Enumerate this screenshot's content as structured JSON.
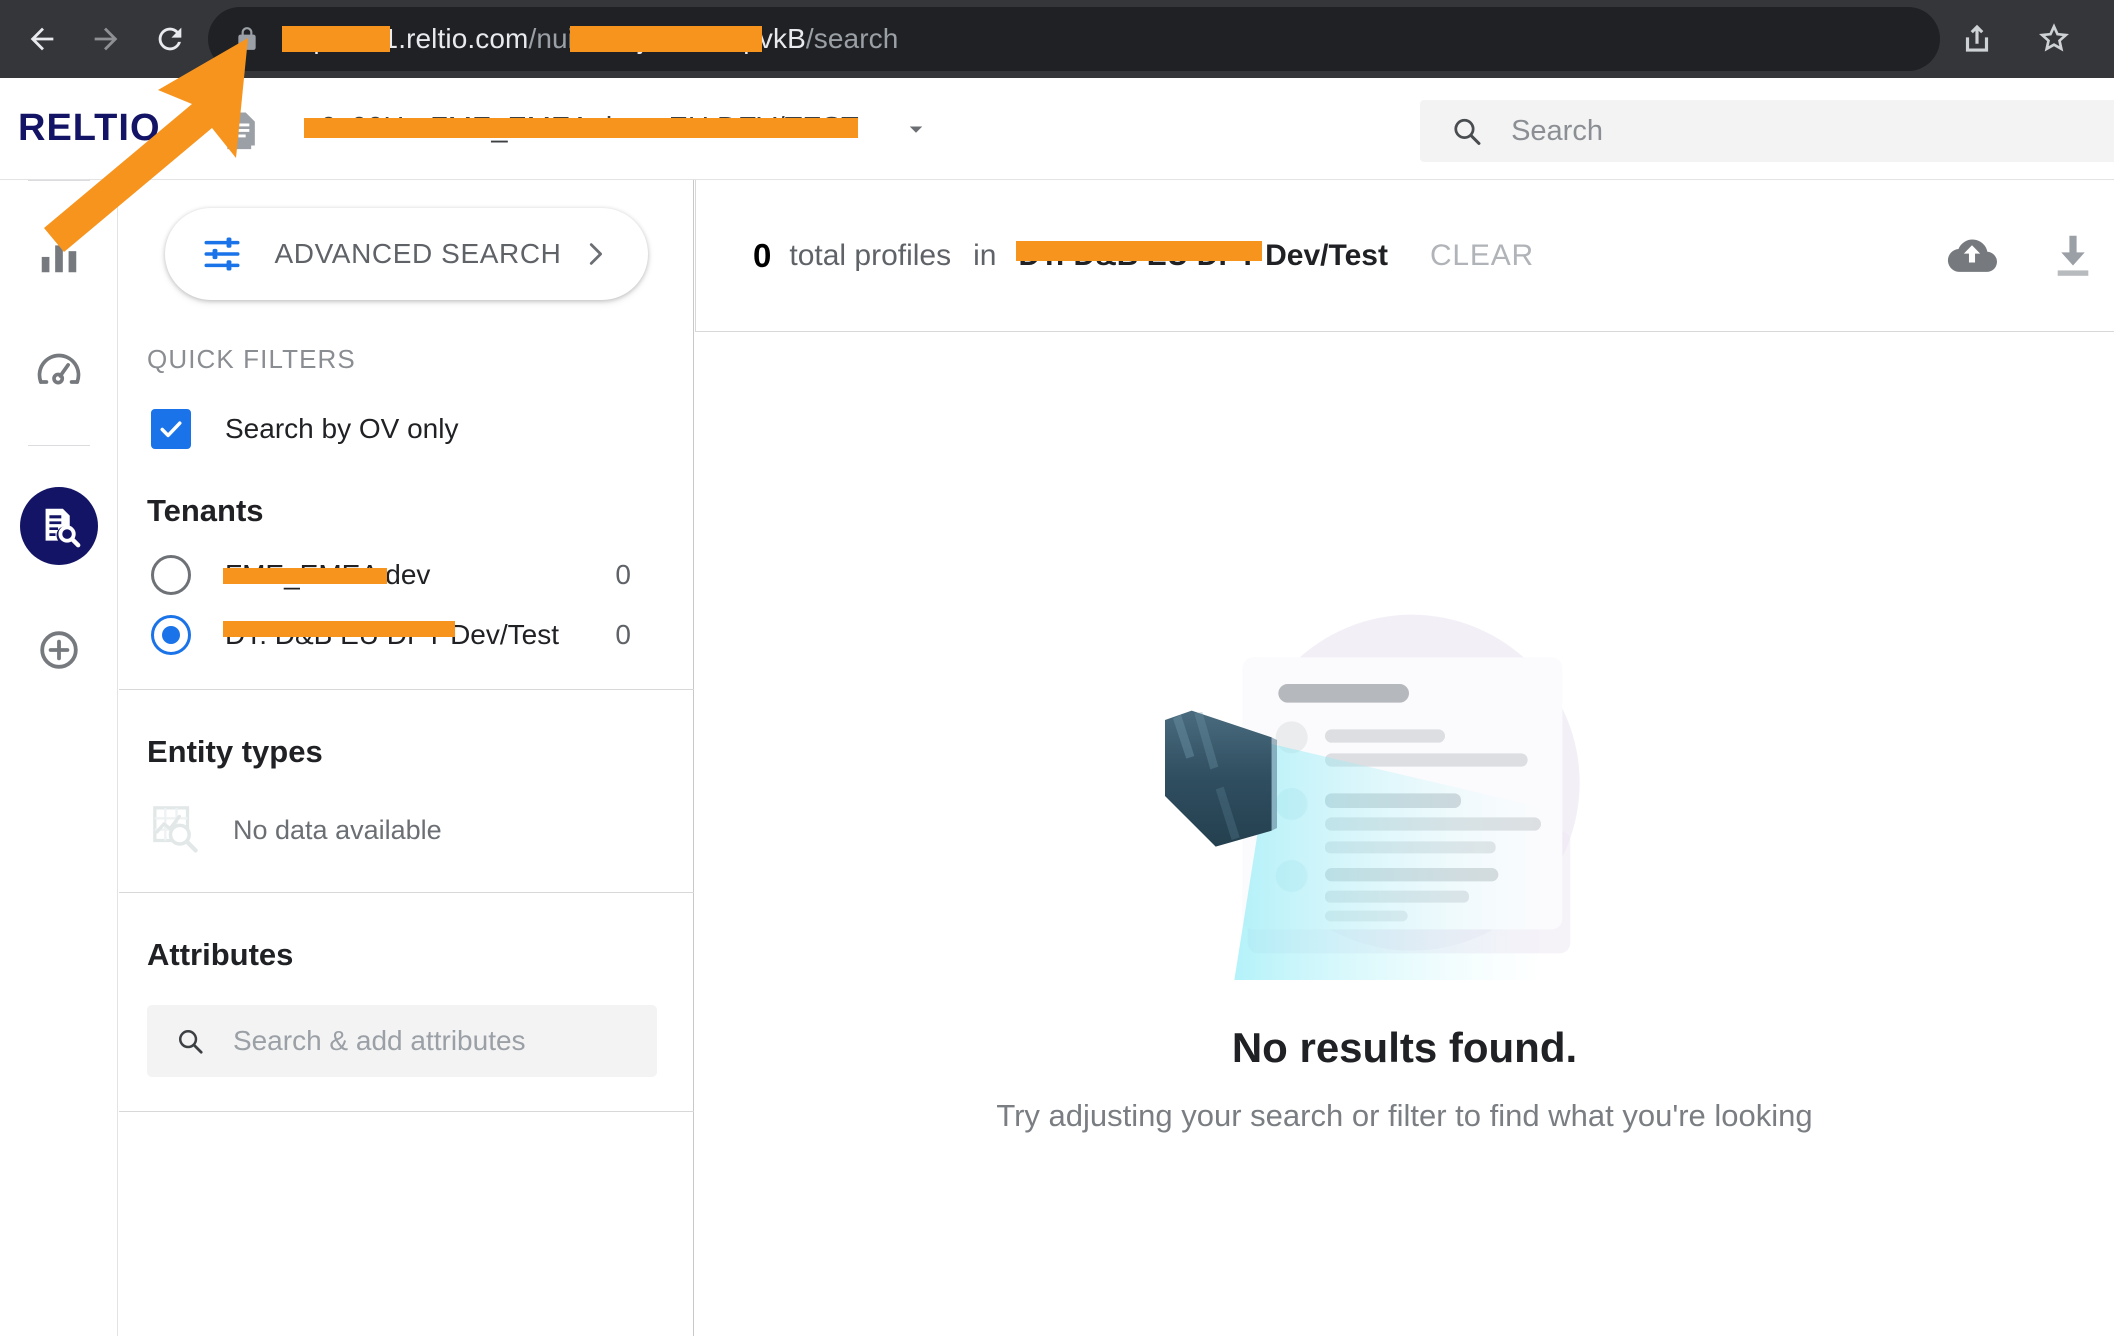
{
  "browser": {
    "back_icon": "back-arrow-icon",
    "forward_icon": "forward-arrow-icon",
    "reload_icon": "reload-icon",
    "lock_icon": "lock-icon",
    "url_prefix_redacted": "",
    "url_visible_1": "01",
    "url_domain": ".reltio.com",
    "url_path_1": "/nui/r",
    "url_redacted_2": "",
    "url_path_2": "/search",
    "share_icon": "share-icon",
    "bookmark_icon": "star-icon"
  },
  "header": {
    "logo": "RELTIO",
    "doc_icon": "document-icon",
    "tenant_name": "",
    "caret_icon": "chevron-down-icon",
    "search": {
      "icon": "search-icon",
      "value": "",
      "placeholder": "Search"
    }
  },
  "rail": {
    "items": [
      {
        "name": "analytics",
        "icon": "bar-chart-icon",
        "active": false
      },
      {
        "name": "dashboard",
        "icon": "gauge-icon",
        "active": false
      },
      {
        "name": "search",
        "icon": "document-search-icon",
        "active": true
      },
      {
        "name": "add",
        "icon": "plus-circle-icon",
        "active": false
      }
    ]
  },
  "facets": {
    "advanced_search": {
      "icon": "filter-sliders-icon",
      "label": "ADVANCED SEARCH",
      "chevron": "chevron-right-icon"
    },
    "quick_filters_title": "QUICK FILTERS",
    "ov_checkbox": {
      "label": "Search by OV only",
      "checked": true,
      "icon": "checkmark-icon"
    },
    "tenants": {
      "title": "Tenants",
      "rows": [
        {
          "label": "",
          "count": "0",
          "selected": false
        },
        {
          "label": "",
          "count": "0",
          "selected": true
        }
      ]
    },
    "entity_types": {
      "title": "Entity types",
      "empty_icon": "chart-search-icon",
      "empty_label": "No data available"
    },
    "attributes": {
      "title": "Attributes",
      "search_icon": "search-icon",
      "value": "",
      "placeholder": "Search & add attributes"
    }
  },
  "results": {
    "count": "0",
    "count_label": "total profiles",
    "in_label": "in",
    "tenant_name": "",
    "clear_label": "CLEAR",
    "upload_icon": "cloud-upload-icon",
    "download_icon": "download-icon",
    "empty": {
      "illustration": "flashlight-document-illustration",
      "title": "No results found.",
      "subtitle": "Try adjusting your search or filter to find what you're looking"
    }
  },
  "annotation": {
    "arrow_icon": "orange-arrow-pointer",
    "color": "#F7941E"
  }
}
